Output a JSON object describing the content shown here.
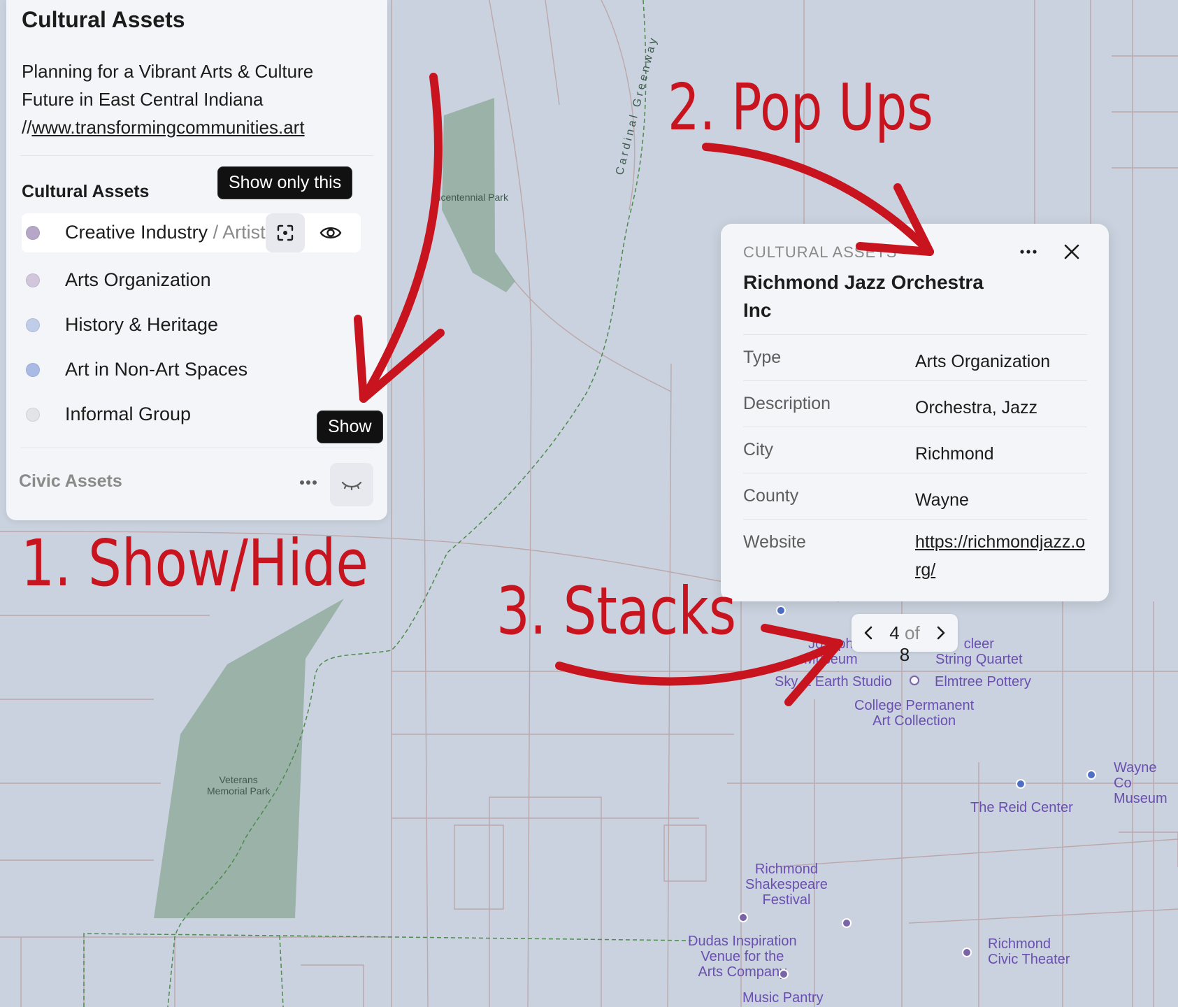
{
  "colors": {
    "map_bg": "#c9d2de",
    "park": "#92ad9f",
    "annotation": "#c8141e",
    "poi_purple": "#7a64a8",
    "poi_blue": "#4f6fc4"
  },
  "legend": {
    "title": "Cultural Assets",
    "description_line1": "Planning for a Vibrant Arts & Culture",
    "description_line2": "Future in East Central Indiana",
    "description_prefix": "//",
    "description_link": "www.transformingcommunities.art",
    "group1": {
      "title": "Cultural Assets",
      "items": [
        {
          "label": "Creative Industry",
          "sublabel": " / Artist",
          "color": "#b6a7c9"
        },
        {
          "label": "Arts Organization",
          "color": "#d2c6dc"
        },
        {
          "label": "History & Heritage",
          "color": "#bfcde8"
        },
        {
          "label": "Art in Non-Art Spaces",
          "color": "#a9bae4"
        },
        {
          "label": "Informal Group",
          "color": "#e4e4e6"
        }
      ],
      "tooltip_show_only": "Show only this",
      "tooltip_show": "Show",
      "icons": [
        "focus-icon",
        "eye-icon"
      ]
    },
    "group2": {
      "title": "Civic Assets",
      "icons": [
        "more-icon",
        "eye-closed-icon"
      ]
    }
  },
  "popup": {
    "category": "CULTURAL ASSETS",
    "title": "Richmond Jazz Orchestra Inc",
    "rows": [
      {
        "key": "Type",
        "value": "Arts Organization"
      },
      {
        "key": "Description",
        "value": "Orchestra, Jazz"
      },
      {
        "key": "City",
        "value": "Richmond"
      },
      {
        "key": "County",
        "value": "Wayne"
      },
      {
        "key": "Website",
        "value": "https://richmondjazz.org/"
      }
    ],
    "icons": [
      "more-icon",
      "close-icon"
    ]
  },
  "pager": {
    "current": "4",
    "of": "of",
    "total": "8"
  },
  "annotations": {
    "a1": "1. Show/Hide",
    "a2": "2. Pop Ups",
    "a3": "3. Stacks"
  },
  "map": {
    "parks": [
      "Bicentennial Park",
      "Veterans\nMemorial Park"
    ],
    "greenway": "Cardinal Greenway",
    "places": [
      "Joseph\nMuseum",
      "cleer\nString Quartet",
      "Sky & Earth Studio",
      "Elmtree Pottery",
      "College Permanent\nArt Collection",
      "Wayne Co\nMuseum",
      "The Reid Center",
      "Richmond\nShakespeare\nFestival",
      "Dudas Inspiration\nVenue for the\nArts Company",
      "Richmond\nCivic Theater",
      "Music Pantry"
    ]
  }
}
